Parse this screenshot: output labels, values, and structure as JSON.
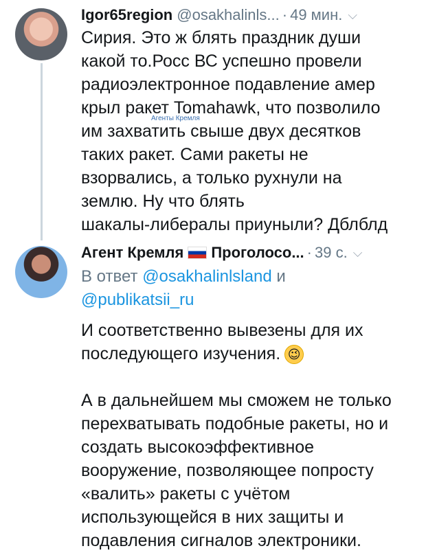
{
  "tweet1": {
    "name": "Igor65region",
    "handle": "@osakhalinls...",
    "time": "49 мин.",
    "lines": [
      "Сирия. Это ж блять праздник души",
      "какой то.Росс ВС успешно провели",
      "радиоэлектронное подавление амер",
      "крыл ракет Tomahawk, что позволило",
      "им захватить свыше двух десятков",
      "таких ракет.  Сами ракеты не",
      "взорвались, а только рухнули на",
      "землю. Ну что блять",
      "шакалы-либералы приуныли? Дблблд"
    ],
    "watermark": "Агенты Кремля"
  },
  "tweet2": {
    "name": "Агент Кремля",
    "name_suffix": "Проголосо...",
    "time": "39 с.",
    "reply_prefix": "В ответ",
    "reply_user1": "@osakhalinlsland",
    "reply_and": "и",
    "reply_user2": "@publikatsii_ru",
    "para1": [
      "И соответственно вывезены для их",
      "последующего изучения."
    ],
    "para2": [
      "А в дальнейшем мы сможем не только",
      "перехватывать подобные ракеты, но и",
      "создать высокоэффективное",
      "вооружение, позволяющее попросту",
      "«валить» ракеты с учётом",
      "использующейся в них защиты и",
      "подавления сигналов электроники."
    ]
  },
  "icons": {
    "chevron": "chevron-down-icon",
    "flag": "russia-flag-icon",
    "emoji": "winking-face-icon"
  },
  "colors": {
    "link": "#1b95e0",
    "secondary": "#657786",
    "text": "#14171a"
  }
}
